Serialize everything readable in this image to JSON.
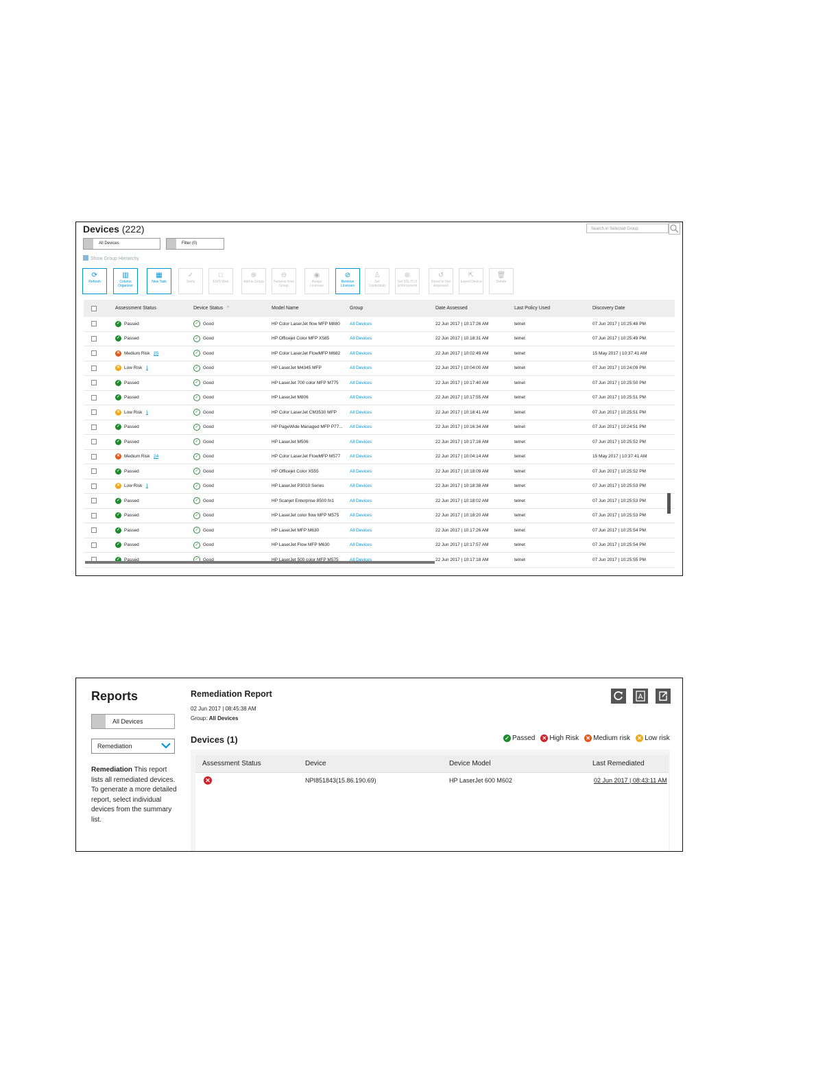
{
  "devices": {
    "title": "Devices",
    "count": "(222)",
    "search_placeholder": "Search in Selected Group",
    "group_dropdown": "All Devices",
    "filter_dropdown": "Filter (0)",
    "show_hierarchy": "Show Group Hierarchy",
    "toolbar": [
      {
        "icon": "refresh-icon",
        "glyph": "⟳",
        "label": "Refresh",
        "active": true
      },
      {
        "icon": "columns-icon",
        "glyph": "▥",
        "label": "Column Organizer",
        "active": true
      },
      {
        "icon": "new-task-icon",
        "glyph": "▦",
        "label": "New Task",
        "active": true
      },
      {
        "icon": "verify-icon",
        "glyph": "✓",
        "label": "Verify",
        "active": false
      },
      {
        "icon": "ews-web-icon",
        "glyph": "□",
        "label": "EWS Web",
        "active": false
      },
      {
        "icon": "add-group-icon",
        "glyph": "⊕",
        "label": "Add to Group",
        "active": false
      },
      {
        "icon": "remove-group-icon",
        "glyph": "⊖",
        "label": "Remove from Group",
        "active": false
      },
      {
        "icon": "assign-license-icon",
        "glyph": "◉",
        "label": "Assign Licenses",
        "active": false
      },
      {
        "icon": "remove-license-icon",
        "glyph": "⊘",
        "label": "Remove Licenses",
        "active": true
      },
      {
        "icon": "credentials-icon",
        "glyph": "♙",
        "label": "Set Credentials",
        "active": false
      },
      {
        "icon": "ssl-icon",
        "glyph": "⊛",
        "label": "Set SSL/TLS Enforcement",
        "active": false
      },
      {
        "icon": "reset-icon",
        "glyph": "↺",
        "label": "Reset to Not Assessed",
        "active": false
      },
      {
        "icon": "export-icon",
        "glyph": "⇱",
        "label": "Export Device",
        "active": false
      },
      {
        "icon": "delete-icon",
        "glyph": "🗑",
        "label": "Delete",
        "active": false
      }
    ],
    "columns": [
      "Assessment Status",
      "Device Status",
      "Model Name",
      "Group",
      "Date Assessed",
      "Last Policy Used",
      "Discovery Date"
    ],
    "sort_arrow": "^",
    "rows": [
      {
        "status": "Passed",
        "level": "pass",
        "count": "",
        "device_status": "Good",
        "model": "HP Color LaserJet flow MFP M880",
        "group": "All Devices",
        "assessed": "22 Jun 2017 | 10:17:26 AM",
        "policy": "telnet",
        "discovered": "07 Jun 2017 | 10:25:48 PM"
      },
      {
        "status": "Passed",
        "level": "pass",
        "count": "",
        "device_status": "Good",
        "model": "HP Officejet Color MFP X585",
        "group": "All Devices",
        "assessed": "22 Jun 2017 | 10:18:31 AM",
        "policy": "telnet",
        "discovered": "07 Jun 2017 | 10:25:49 PM"
      },
      {
        "status": "Medium Risk",
        "level": "med",
        "count": "25",
        "device_status": "Good",
        "model": "HP Color LaserJet FlowMFP M682",
        "group": "All Devices",
        "assessed": "22 Jun 2017 | 10:02:49 AM",
        "policy": "telnet",
        "discovered": "15 May 2017 | 10:37:41 AM"
      },
      {
        "status": "Low Risk",
        "level": "low",
        "count": "1",
        "device_status": "Good",
        "model": "HP LaserJet M4345 MFP",
        "group": "All Devices",
        "assessed": "22 Jun 2017 | 10:04:00 AM",
        "policy": "telnet",
        "discovered": "07 Jun 2017 | 10:24:09 PM"
      },
      {
        "status": "Passed",
        "level": "pass",
        "count": "",
        "device_status": "Good",
        "model": "HP LaserJet 700 color MFP M775",
        "group": "All Devices",
        "assessed": "22 Jun 2017 | 10:17:40 AM",
        "policy": "telnet",
        "discovered": "07 Jun 2017 | 10:25:50 PM"
      },
      {
        "status": "Passed",
        "level": "pass",
        "count": "",
        "device_status": "Good",
        "model": "HP LaserJet M806",
        "group": "All Devices",
        "assessed": "22 Jun 2017 | 10:17:55 AM",
        "policy": "telnet",
        "discovered": "07 Jun 2017 | 10:25:51 PM"
      },
      {
        "status": "Low Risk",
        "level": "low",
        "count": "1",
        "device_status": "Good",
        "model": "HP Color LaserJet CM3530 MFP",
        "group": "All Devices",
        "assessed": "22 Jun 2017 | 10:18:41 AM",
        "policy": "telnet",
        "discovered": "07 Jun 2017 | 10:25:51 PM"
      },
      {
        "status": "Passed",
        "level": "pass",
        "count": "",
        "device_status": "Good",
        "model": "HP PageWide Managed MFP P77...",
        "group": "All Devices",
        "assessed": "22 Jun 2017 | 10:16:34 AM",
        "policy": "telnet",
        "discovered": "07 Jun 2017 | 10:24:51 PM"
      },
      {
        "status": "Passed",
        "level": "pass",
        "count": "",
        "device_status": "Good",
        "model": "HP LaserJet M506",
        "group": "All Devices",
        "assessed": "22 Jun 2017 | 10:17:16 AM",
        "policy": "telnet",
        "discovered": "07 Jun 2017 | 10:25:52 PM"
      },
      {
        "status": "Medium Risk",
        "level": "med",
        "count": "24",
        "device_status": "Good",
        "model": "HP Color LaserJet FlowMFP M577",
        "group": "All Devices",
        "assessed": "22 Jun 2017 | 10:04:14 AM",
        "policy": "telnet",
        "discovered": "15 May 2017 | 10:37:41 AM"
      },
      {
        "status": "Passed",
        "level": "pass",
        "count": "",
        "device_status": "Good",
        "model": "HP Officejet Color X555",
        "group": "All Devices",
        "assessed": "22 Jun 2017 | 10:18:09 AM",
        "policy": "telnet",
        "discovered": "07 Jun 2017 | 10:25:52 PM"
      },
      {
        "status": "Low Risk",
        "level": "low",
        "count": "1",
        "device_status": "Good",
        "model": "HP LaserJet P3010 Series",
        "group": "All Devices",
        "assessed": "22 Jun 2017 | 10:18:38 AM",
        "policy": "telnet",
        "discovered": "07 Jun 2017 | 10:25:53 PM"
      },
      {
        "status": "Passed",
        "level": "pass",
        "count": "",
        "device_status": "Good",
        "model": "HP Scanjet Enterprise 8500 fn1",
        "group": "All Devices",
        "assessed": "22 Jun 2017 | 10:18:02 AM",
        "policy": "telnet",
        "discovered": "07 Jun 2017 | 10:25:53 PM"
      },
      {
        "status": "Passed",
        "level": "pass",
        "count": "",
        "device_status": "Good",
        "model": "HP LaserJet color flow MFP M575",
        "group": "All Devices",
        "assessed": "22 Jun 2017 | 10:18:20 AM",
        "policy": "telnet",
        "discovered": "07 Jun 2017 | 10:25:53 PM"
      },
      {
        "status": "Passed",
        "level": "pass",
        "count": "",
        "device_status": "Good",
        "model": "HP LaserJet MFP M630",
        "group": "All Devices",
        "assessed": "22 Jun 2017 | 10:17:26 AM",
        "policy": "telnet",
        "discovered": "07 Jun 2017 | 10:25:54 PM"
      },
      {
        "status": "Passed",
        "level": "pass",
        "count": "",
        "device_status": "Good",
        "model": "HP LaserJet Flow MFP M630",
        "group": "All Devices",
        "assessed": "22 Jun 2017 | 10:17:57 AM",
        "policy": "telnet",
        "discovered": "07 Jun 2017 | 10:25:54 PM"
      },
      {
        "status": "Passed",
        "level": "pass",
        "count": "",
        "device_status": "Good",
        "model": "HP LaserJet 500 color MFP M575",
        "group": "All Devices",
        "assessed": "22 Jun 2017 | 10:17:18 AM",
        "policy": "telnet",
        "discovered": "07 Jun 2017 | 10:25:55 PM"
      }
    ]
  },
  "reports": {
    "title": "Reports",
    "group_dropdown": "All Devices",
    "report_select": "Remediation",
    "description_bold": "Remediation",
    "description": " This report lists all remediated devices. To generate a more detailed report, select individual devices from the summary list.",
    "report_name": "Remediation Report",
    "report_date": "02 Jun 2017 | 08:45:38 AM",
    "group_label": "Group:",
    "group_value": "All Devices",
    "devices_label": "Devices (1)",
    "actions": [
      {
        "icon": "refresh-icon",
        "glyph": "⟳"
      },
      {
        "icon": "pdf-icon",
        "glyph": "⛶"
      },
      {
        "icon": "export-icon",
        "glyph": "⇱"
      }
    ],
    "legend": [
      {
        "label": "Passed",
        "color": "#1b8b2b",
        "glyph": "✓"
      },
      {
        "label": "High Risk",
        "color": "#d0202a",
        "glyph": "✕"
      },
      {
        "label": "Medium risk",
        "color": "#e05a1d",
        "glyph": "✕"
      },
      {
        "label": "Low risk",
        "color": "#f0a81a",
        "glyph": "✕"
      }
    ],
    "columns": [
      "Assessment Status",
      "Device",
      "Device Model",
      "Last Remediated"
    ],
    "rows": [
      {
        "status_color": "#d0202a",
        "device": "NPI851843(15.86.190.69)",
        "model": "HP LaserJet 600 M602",
        "last_remediated": "02 Jun 2017 | 08:43:11 AM"
      }
    ]
  },
  "colors": {
    "accent": "#0096d6",
    "pass": "#1b8b2b",
    "medium": "#e05a1d",
    "low": "#f0a81a",
    "high": "#d0202a"
  }
}
